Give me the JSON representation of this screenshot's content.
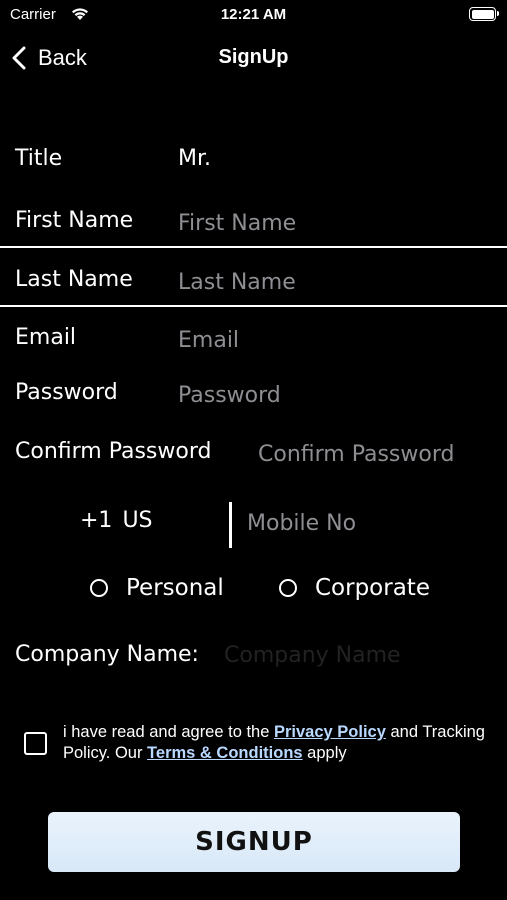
{
  "status_bar": {
    "carrier": "Carrier",
    "time": "12:21 AM",
    "icons": [
      "wifi-icon",
      "battery-icon"
    ]
  },
  "nav": {
    "back_label": "Back",
    "title": "SignUp"
  },
  "form": {
    "title": {
      "label": "Title",
      "value": "Mr."
    },
    "first_name": {
      "label": "First Name",
      "placeholder": "First Name"
    },
    "last_name": {
      "label": "Last Name",
      "placeholder": "Last Name"
    },
    "email": {
      "label": "Email",
      "placeholder": "Email"
    },
    "password": {
      "label": "Password",
      "placeholder": "Password"
    },
    "confirm_password": {
      "label": "Confirm Password",
      "placeholder": "Confirm Password"
    },
    "phone": {
      "country_code": "+1",
      "country": "US",
      "placeholder": "Mobile No"
    },
    "account_type": {
      "options": [
        "Personal",
        "Corporate"
      ]
    },
    "company": {
      "label": "Company Name:",
      "placeholder": "Company Name"
    }
  },
  "agreement": {
    "text_1": "i have read and agree to the ",
    "privacy_link": "Privacy Policy",
    "text_2": " and Tracking Policy. Our ",
    "terms_link": "Terms & Conditions",
    "text_3": " apply"
  },
  "signup_button": {
    "label": "SIGNUP"
  },
  "colors": {
    "background": "#000000",
    "text": "#ffffff",
    "placeholder": "#8e8e93",
    "link": "#b9d8ff",
    "button": "#e3effa"
  }
}
